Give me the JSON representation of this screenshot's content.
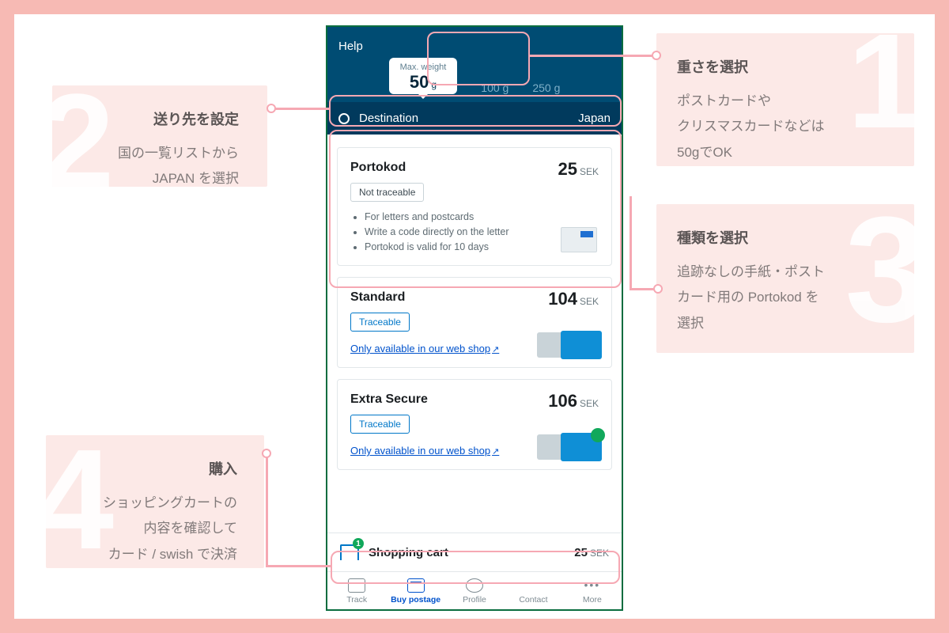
{
  "annotations": {
    "a1": {
      "num": "1",
      "title": "重さを選択",
      "line1": "ポストカードや",
      "line2": "クリスマスカードなどは",
      "line3": "50gでOK"
    },
    "a2": {
      "num": "2",
      "title": "送り先を設定",
      "line1": "国の一覧リストから",
      "line2": "JAPAN を選択"
    },
    "a3": {
      "num": "3",
      "title": "種類を選択",
      "line1": "追跡なしの手紙・ポスト",
      "line2": "カード用の Portokod を",
      "line3": "選択"
    },
    "a4": {
      "num": "4",
      "title": "購入",
      "line1": "ショッピングカートの",
      "line2": "内容を確認して",
      "line3": "カード / swish で決済"
    }
  },
  "app": {
    "help": "Help",
    "max_weight_label": "Max. weight",
    "weight_selected_value": "50",
    "weight_unit": "g",
    "weight_100": "100 g",
    "weight_250": "250 g",
    "destination_label": "Destination",
    "destination_value": "Japan",
    "portokod": {
      "name": "Portokod",
      "price": "25",
      "currency": "SEK",
      "badge": "Not traceable",
      "b1": "For letters and postcards",
      "b2": "Write a code directly on the letter",
      "b3": "Portokod is valid for 10 days"
    },
    "standard": {
      "name": "Standard",
      "price": "104",
      "currency": "SEK",
      "badge": "Traceable",
      "link": "Only available in our web shop"
    },
    "extra": {
      "name": "Extra Secure",
      "price": "106",
      "currency": "SEK",
      "badge": "Traceable",
      "link": "Only available in our web shop"
    },
    "cart": {
      "count": "1",
      "label": "Shopping cart",
      "price": "25",
      "currency": "SEK"
    },
    "tabs": {
      "track": "Track",
      "buy": "Buy postage",
      "profile": "Profile",
      "contact": "Contact",
      "more": "More"
    }
  }
}
